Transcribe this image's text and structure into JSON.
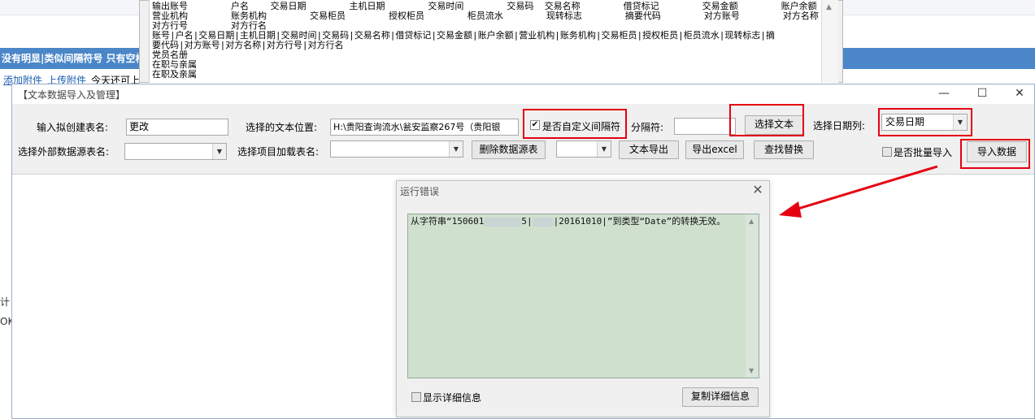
{
  "background_page": {
    "blue_bar_text": "没有明显|类似间隔符号 只有空格",
    "links": [
      "添加附件",
      "上传附件"
    ],
    "extra_text": "今天还可上",
    "side_fragments": [
      "计",
      "OK"
    ]
  },
  "preview": {
    "lines": [
      "输出账号        户名    交易日期        主机日期        交易时间        交易码  交易名称        借贷标记        交易金额        账户余额",
      "营业机构        账务机构        交易柜员        授权柜员        柜员流水        现转标志        摘要代码        对方账号        对方名称",
      "对方行号        对方行名",
      "账号|户名|交易日期|主机日期|交易时间|交易码|交易名称|借贷标记|交易金额|账户余额|营业机构|账务机构|交易柜员|授权柜员|柜员流水|现转标志|摘",
      "要代码|对方账号|对方名称|对方行号|对方行名",
      "党员名册",
      "在职与亲属",
      "在职及亲属"
    ]
  },
  "window": {
    "title": "【文本数据导入及管理】",
    "controls": [
      "—",
      "☐",
      "✕"
    ]
  },
  "toolbar": {
    "table_name_label": "输入拟创建表名:",
    "table_name_value": "更改",
    "text_location_label": "选择的文本位置:",
    "text_location_value": "H:\\贵阳查询流水\\瓮安监察267号（贵阳银",
    "custom_separator_label": "是否自定义间隔符",
    "custom_separator_checked": true,
    "separator_label": "分隔符:",
    "separator_value": "",
    "select_text_button": "选择文本",
    "date_column_label": "选择日期列:",
    "date_column_value": "交易日期",
    "external_table_label": "选择外部数据源表名:",
    "project_table_label": "选择项目加载表名:",
    "delete_source_button": "删除数据源表",
    "text_export_button": "文本导出",
    "export_excel_button": "导出excel",
    "find_replace_button": "查找替换",
    "batch_import_label": "是否批量导入",
    "batch_import_checked": false,
    "import_data_button": "导入数据"
  },
  "dialog": {
    "title": "运行错误",
    "message_prefix": "从字符串“150601",
    "message_mid1": "5|",
    "message_mid2": "|20161010|”到类型“Date”的转换无效。",
    "show_details_label": "显示详细信息",
    "copy_details_button": "复制详细信息"
  },
  "colors": {
    "highlight_red": "#e60012",
    "blue_bar": "#4a86c8",
    "message_bg": "#cfe0cf"
  }
}
